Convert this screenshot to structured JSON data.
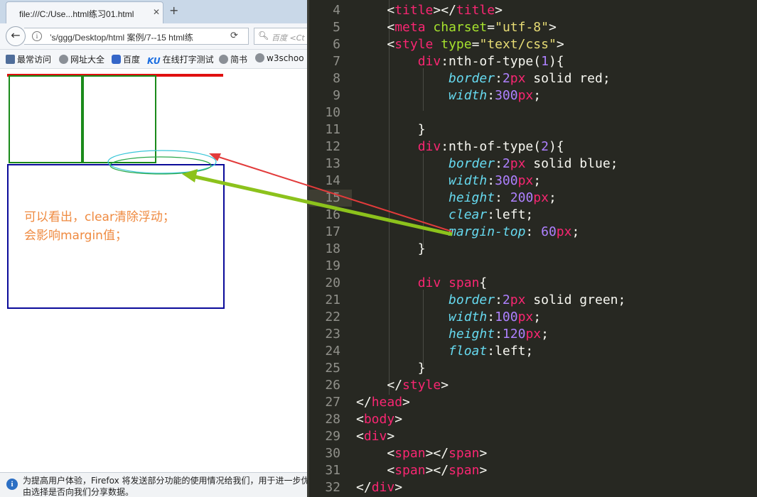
{
  "browser": {
    "tab_title": "file:///C:/Use...html练习01.html",
    "tab_close": "✕",
    "new_tab": "+",
    "url": "’s/ggg/Desktop/html 案例/7--15 html练",
    "search_placeholder": "百度 <Ct",
    "bookmarks": [
      "最常访问",
      "网址大全",
      "百度",
      "在线打字测试",
      "简书",
      "w3schoo"
    ],
    "ku_icon": "KU",
    "annotation_line1": "可以看出，clear清除浮动；",
    "annotation_line2": "会影响margin值；",
    "status_line1": "为提高用户体验，Firefox 将发送部分功能的使用情况给我们，用于进一步优",
    "status_line2": "由选择是否向我们分享数据。",
    "status_icon_letter": "i"
  },
  "colors": {
    "div1_border": "#e01010",
    "div2_border": "#0a0a9a",
    "span_border": "#1a8a1a",
    "annotation_text": "#ef8a40",
    "editor_bg": "#272822"
  },
  "editor": {
    "current_line": 15,
    "lines": [
      {
        "n": "4",
        "indent": 1,
        "tokens": [
          [
            "t-punc",
            "<"
          ],
          [
            "t-tag",
            "title"
          ],
          [
            "t-punc",
            "></"
          ],
          [
            "t-tag",
            "title"
          ],
          [
            "t-punc",
            ">"
          ]
        ]
      },
      {
        "n": "5",
        "indent": 1,
        "tokens": [
          [
            "t-punc",
            "<"
          ],
          [
            "t-tag",
            "meta"
          ],
          [
            "t-plain",
            " "
          ],
          [
            "t-attr",
            "charset"
          ],
          [
            "t-punc",
            "="
          ],
          [
            "t-str",
            "\"utf-8\""
          ],
          [
            "t-punc",
            ">"
          ]
        ]
      },
      {
        "n": "6",
        "indent": 1,
        "tokens": [
          [
            "t-punc",
            "<"
          ],
          [
            "t-tag",
            "style"
          ],
          [
            "t-plain",
            " "
          ],
          [
            "t-attr",
            "type"
          ],
          [
            "t-punc",
            "="
          ],
          [
            "t-str",
            "\"text/css\""
          ],
          [
            "t-punc",
            ">"
          ]
        ]
      },
      {
        "n": "7",
        "indent": 2,
        "tokens": [
          [
            "t-tag",
            "div"
          ],
          [
            "t-plain",
            ":nth-of-type("
          ],
          [
            "t-num",
            "1"
          ],
          [
            "t-plain",
            "){"
          ]
        ]
      },
      {
        "n": "8",
        "indent": 3,
        "tokens": [
          [
            "t-prop",
            "border"
          ],
          [
            "t-plain",
            ":"
          ],
          [
            "t-num",
            "2"
          ],
          [
            "t-tag",
            "px"
          ],
          [
            "t-plain",
            " solid red;"
          ]
        ]
      },
      {
        "n": "9",
        "indent": 3,
        "tokens": [
          [
            "t-prop",
            "width"
          ],
          [
            "t-plain",
            ":"
          ],
          [
            "t-num",
            "300"
          ],
          [
            "t-tag",
            "px"
          ],
          [
            "t-plain",
            ";"
          ]
        ]
      },
      {
        "n": "10",
        "indent": 0,
        "tokens": []
      },
      {
        "n": "11",
        "indent": 2,
        "tokens": [
          [
            "t-plain",
            "}"
          ]
        ]
      },
      {
        "n": "12",
        "indent": 2,
        "tokens": [
          [
            "t-tag",
            "div"
          ],
          [
            "t-plain",
            ":nth-of-type("
          ],
          [
            "t-num",
            "2"
          ],
          [
            "t-plain",
            "){"
          ]
        ]
      },
      {
        "n": "13",
        "indent": 3,
        "tokens": [
          [
            "t-prop",
            "border"
          ],
          [
            "t-plain",
            ":"
          ],
          [
            "t-num",
            "2"
          ],
          [
            "t-tag",
            "px"
          ],
          [
            "t-plain",
            " solid blue;"
          ]
        ]
      },
      {
        "n": "14",
        "indent": 3,
        "tokens": [
          [
            "t-prop",
            "width"
          ],
          [
            "t-plain",
            ":"
          ],
          [
            "t-num",
            "300"
          ],
          [
            "t-tag",
            "px"
          ],
          [
            "t-plain",
            ";"
          ]
        ]
      },
      {
        "n": "15",
        "indent": 3,
        "tokens": [
          [
            "t-prop",
            "height"
          ],
          [
            "t-plain",
            ": "
          ],
          [
            "t-num",
            "200"
          ],
          [
            "t-tag",
            "px"
          ],
          [
            "t-plain",
            ";"
          ]
        ]
      },
      {
        "n": "16",
        "indent": 3,
        "tokens": [
          [
            "t-prop",
            "clear"
          ],
          [
            "t-plain",
            ":left;"
          ]
        ]
      },
      {
        "n": "17",
        "indent": 3,
        "tokens": [
          [
            "t-prop",
            "margin-top"
          ],
          [
            "t-plain",
            ": "
          ],
          [
            "t-num",
            "60"
          ],
          [
            "t-tag",
            "px"
          ],
          [
            "t-plain",
            ";"
          ]
        ]
      },
      {
        "n": "18",
        "indent": 2,
        "tokens": [
          [
            "t-plain",
            "}"
          ]
        ]
      },
      {
        "n": "19",
        "indent": 0,
        "tokens": []
      },
      {
        "n": "20",
        "indent": 2,
        "tokens": [
          [
            "t-tag",
            "div"
          ],
          [
            "t-plain",
            " "
          ],
          [
            "t-tag",
            "span"
          ],
          [
            "t-plain",
            "{"
          ]
        ]
      },
      {
        "n": "21",
        "indent": 3,
        "tokens": [
          [
            "t-prop",
            "border"
          ],
          [
            "t-plain",
            ":"
          ],
          [
            "t-num",
            "2"
          ],
          [
            "t-tag",
            "px"
          ],
          [
            "t-plain",
            " solid green;"
          ]
        ]
      },
      {
        "n": "22",
        "indent": 3,
        "tokens": [
          [
            "t-prop",
            "width"
          ],
          [
            "t-plain",
            ":"
          ],
          [
            "t-num",
            "100"
          ],
          [
            "t-tag",
            "px"
          ],
          [
            "t-plain",
            ";"
          ]
        ]
      },
      {
        "n": "23",
        "indent": 3,
        "tokens": [
          [
            "t-prop",
            "height"
          ],
          [
            "t-plain",
            ":"
          ],
          [
            "t-num",
            "120"
          ],
          [
            "t-tag",
            "px"
          ],
          [
            "t-plain",
            ";"
          ]
        ]
      },
      {
        "n": "24",
        "indent": 3,
        "tokens": [
          [
            "t-prop",
            "float"
          ],
          [
            "t-plain",
            ":left;"
          ]
        ]
      },
      {
        "n": "25",
        "indent": 2,
        "tokens": [
          [
            "t-plain",
            "}"
          ]
        ]
      },
      {
        "n": "26",
        "indent": 1,
        "tokens": [
          [
            "t-punc",
            "</"
          ],
          [
            "t-tag",
            "style"
          ],
          [
            "t-punc",
            ">"
          ]
        ]
      },
      {
        "n": "27",
        "indent": 0,
        "tokens": [
          [
            "t-punc",
            "</"
          ],
          [
            "t-tag",
            "head"
          ],
          [
            "t-punc",
            ">"
          ]
        ]
      },
      {
        "n": "28",
        "indent": 0,
        "tokens": [
          [
            "t-punc",
            "<"
          ],
          [
            "t-tag",
            "body"
          ],
          [
            "t-punc",
            ">"
          ]
        ]
      },
      {
        "n": "29",
        "indent": 0,
        "tokens": [
          [
            "t-punc",
            "<"
          ],
          [
            "t-tag",
            "div"
          ],
          [
            "t-punc",
            ">"
          ]
        ]
      },
      {
        "n": "30",
        "indent": 1,
        "tokens": [
          [
            "t-punc",
            "<"
          ],
          [
            "t-tag",
            "span"
          ],
          [
            "t-punc",
            "></"
          ],
          [
            "t-tag",
            "span"
          ],
          [
            "t-punc",
            ">"
          ]
        ]
      },
      {
        "n": "31",
        "indent": 1,
        "tokens": [
          [
            "t-punc",
            "<"
          ],
          [
            "t-tag",
            "span"
          ],
          [
            "t-punc",
            "></"
          ],
          [
            "t-tag",
            "span"
          ],
          [
            "t-punc",
            ">"
          ]
        ]
      },
      {
        "n": "32",
        "indent": 0,
        "tokens": [
          [
            "t-punc",
            "</"
          ],
          [
            "t-tag",
            "div"
          ],
          [
            "t-punc",
            ">"
          ]
        ]
      }
    ]
  }
}
